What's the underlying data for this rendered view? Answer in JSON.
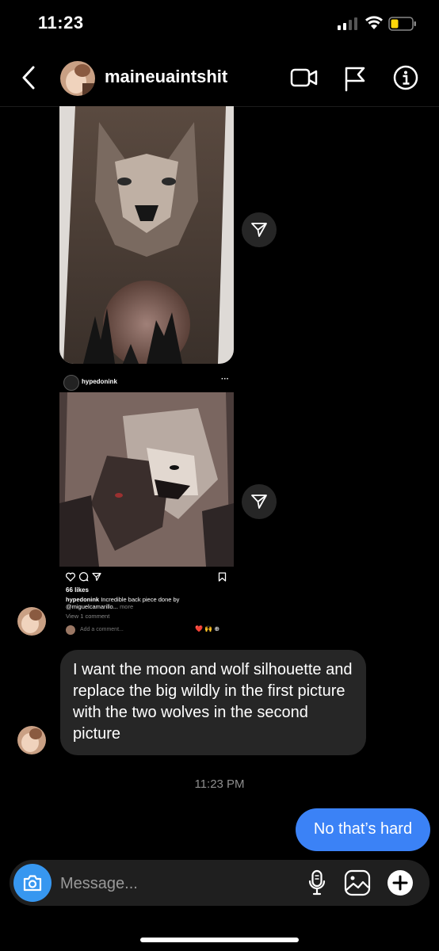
{
  "status_bar": {
    "time": "11:23"
  },
  "header": {
    "username": "maineuaintshit"
  },
  "shared_post": {
    "username": "hypedonink",
    "more_glyph": "···",
    "likes": "66 likes",
    "caption_user": "hypedonink",
    "caption_text": "Incredible back piece done by @miguelcamarillo...",
    "caption_more": "more",
    "view_comments": "View 1 comment",
    "add_comment_placeholder": "Add a comment...",
    "emojis": "❤️ 🙌 ⊕"
  },
  "messages": {
    "incoming_text": "I want the moon and wolf silhouette and replace the big wildly in the first picture with the two wolves in the second picture",
    "timestamp": "11:23 PM",
    "outgoing_text": "No that’s hard"
  },
  "composer": {
    "placeholder": "Message..."
  },
  "colors": {
    "accent": "#3797f0",
    "outgoing_bubble": "#3b82f6",
    "incoming_bubble": "#262626",
    "battery": "#ffd60a"
  },
  "icons": [
    "back-chevron-icon",
    "video-call-icon",
    "flag-icon",
    "info-icon",
    "share-icon",
    "heart-icon",
    "comment-icon",
    "send-icon",
    "bookmark-icon",
    "camera-icon",
    "microphone-icon",
    "gallery-icon",
    "plus-icon"
  ]
}
